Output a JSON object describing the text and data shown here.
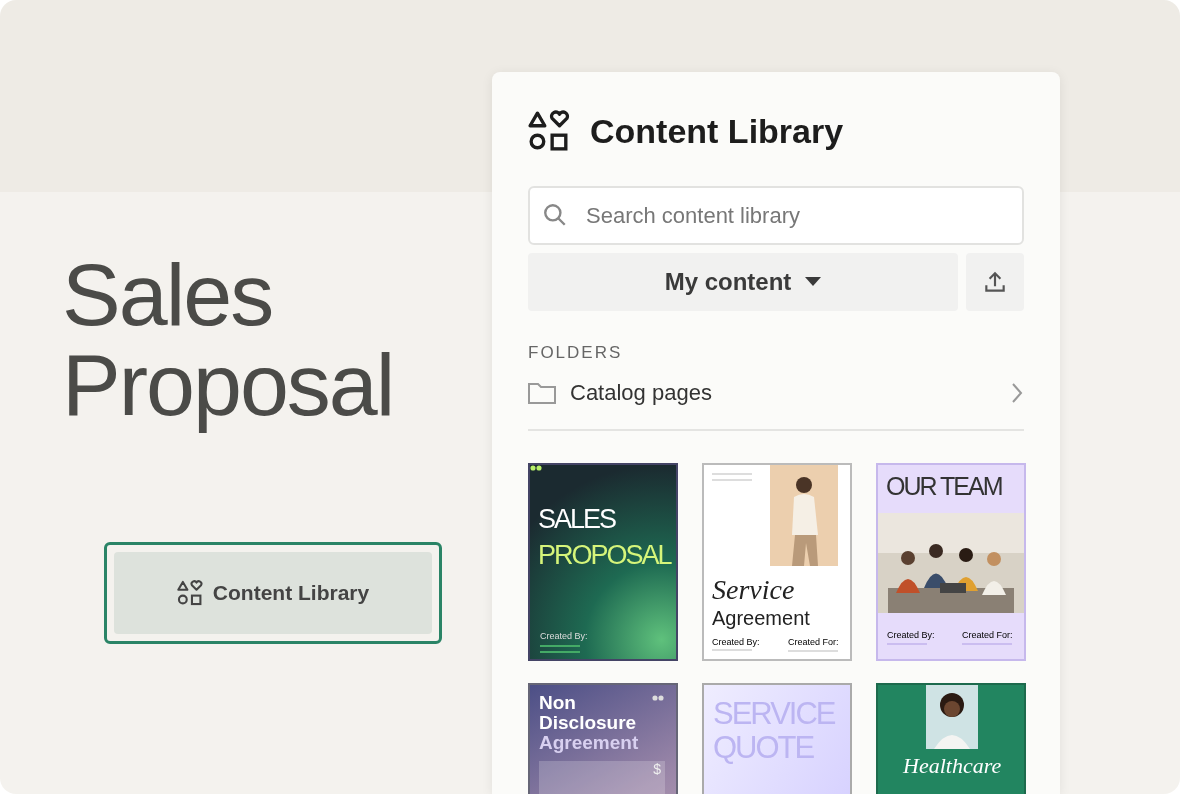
{
  "hero": {
    "title": "Sales Proposal",
    "button": {
      "label": "Content Library",
      "focused": true
    }
  },
  "panel": {
    "title": "Content Library",
    "search": {
      "placeholder": "Search content library"
    },
    "filter": {
      "label": "My content"
    },
    "section": "FOLDERS",
    "folders": [
      {
        "name": "Catalog pages"
      }
    ],
    "templates": [
      {
        "kind": "sales",
        "lines": [
          "SALES",
          "PROPOSAL"
        ],
        "created_by": "Created By:"
      },
      {
        "kind": "service",
        "lines": [
          "Service",
          "Agreement"
        ],
        "created_by": "Created By:",
        "created_for": "Created For:"
      },
      {
        "kind": "team",
        "lines": [
          "OUR TEAM"
        ],
        "created_by": "Created By:",
        "created_for": "Created For:"
      },
      {
        "kind": "nda",
        "lines": [
          "Non",
          "Disclosure",
          "Agreement"
        ],
        "symbol": "$"
      },
      {
        "kind": "quote",
        "lines": [
          "SERVICE",
          "QUOTE"
        ]
      },
      {
        "kind": "health",
        "lines": [
          "Healthcare"
        ]
      }
    ]
  }
}
